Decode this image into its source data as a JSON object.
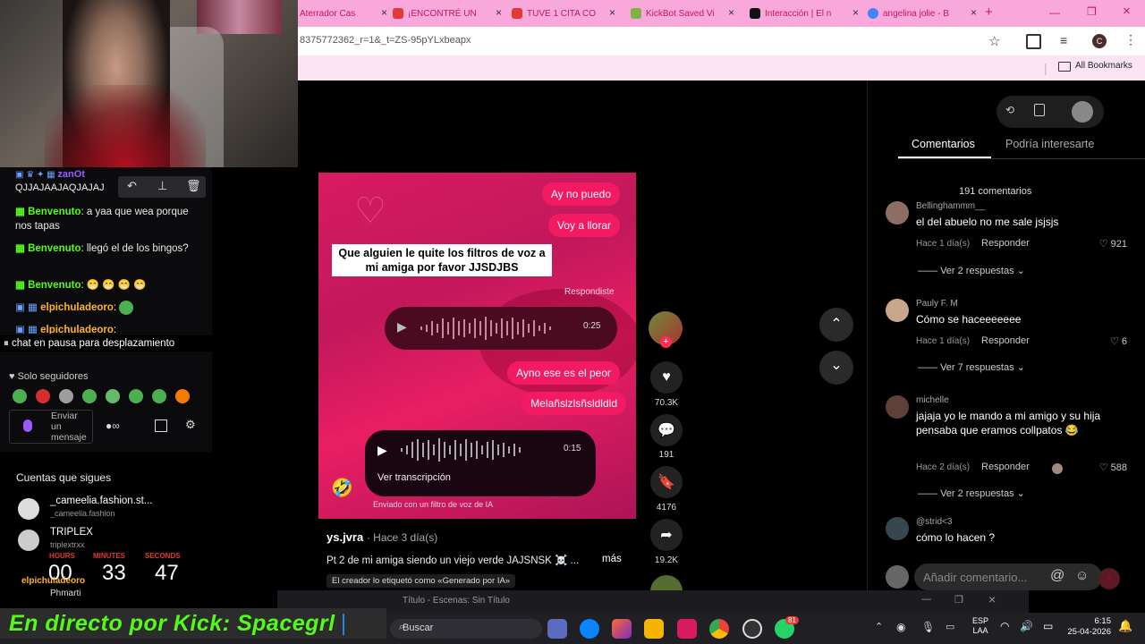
{
  "browser": {
    "tabs": [
      {
        "label": "Aterrador Cas",
        "color": "#d32f2f"
      },
      {
        "label": "¡ENCONTRÉ UN",
        "color": "#e53935"
      },
      {
        "label": "TUVE 1 CITA CO",
        "color": "#e53935"
      },
      {
        "label": "KickBot Saved Vi",
        "color": "#7cb342"
      },
      {
        "label": "Interacción | El n",
        "color": "#111111"
      },
      {
        "label": "angelina jolie - B",
        "color": "#4285f4"
      }
    ],
    "new_tab": "+",
    "url": "8375772362_r=1&_t=ZS-95pYLxbeapx",
    "profile_initial": "C",
    "all_bookmarks": "All Bookmarks"
  },
  "chat": {
    "top_user": "zanOt",
    "top_msg": "QJJAJAAJAQJAJAJ",
    "messages": [
      {
        "user": "Benvenuto",
        "text": "a yaa que wea porque nos tapas"
      },
      {
        "user": "Benvenuto",
        "text": "llegó el de los bingos?"
      },
      {
        "user": "Benvenuto",
        "text": "😁 😁 😁 😁"
      },
      {
        "user": "elpichuladeoro",
        "text": ""
      },
      {
        "user": "elpichuladeoro",
        "text": ""
      }
    ],
    "paused": "chat en pausa para desplazamiento",
    "followers_only": "Solo seguidores",
    "send_placeholder": "Enviar un mensaje"
  },
  "following": {
    "title": "Cuentas que sigues",
    "accounts": [
      {
        "name": "_cameelia.fashion.st...",
        "handle": "_cameelia.fashion"
      },
      {
        "name": "TRIPLEX",
        "handle": "triplextrxx"
      }
    ],
    "timer_labels": {
      "hours": "HOURS",
      "minutes": "MINUTES",
      "seconds": "SECONDS"
    },
    "timer": {
      "hours": "00",
      "minutes": "33",
      "seconds": "47"
    },
    "small_user_1": "elpichuladeoro",
    "small_user_2": "Phmarti"
  },
  "banner": "En directo por Kick: Spacegrl",
  "video": {
    "bubbles_top": [
      "Ay no puedo",
      "Voy a llorar"
    ],
    "caption": "Que alguien le quite los filtros de voz a mi amiga por favor JJSDJBS",
    "respondiste": "Respondiste",
    "audio1_time": "0:25",
    "bubbles_mid": [
      "Ayno ese es el peor",
      "Melañslzlsñsldldld"
    ],
    "audio2_time": "0:15",
    "transcription": "Ver transcripción",
    "ai_note": "Enviado con un filtro de voz de IA",
    "author": "ys.jvra",
    "time_ago": "· Hace 3 día(s)",
    "description": "Pt 2 de mi amiga siendo un viejo verde JAJSNSK ☠️ ...",
    "more": "más",
    "ai_label": "El creador lo etiquetó como «Generado por IA»"
  },
  "actions": {
    "likes": "70.3K",
    "comments": "191",
    "saves": "4176",
    "shares": "19.2K"
  },
  "comments_panel": {
    "tab_comments": "Comentarios",
    "tab_interest": "Podría interesarte",
    "count": "191 comentarios",
    "reply_label": "Responder",
    "items": [
      {
        "user": "Bellinghammm__",
        "text": "el del abuelo no me sale jsjsjs",
        "time": "Hace 1 día(s)",
        "likes": "921",
        "replies": "Ver 2 respuestas"
      },
      {
        "user": "Pauly F. M",
        "text": "Cómo se haceeeeeee",
        "time": "Hace 1 día(s)",
        "likes": "6",
        "replies": "Ver 7 respuestas"
      },
      {
        "user": "michelle",
        "text": "jajaja yo le mando a mi amigo y su hija pensaba que eramos collpatos 😂",
        "time": "Hace 2 día(s)",
        "likes": "588",
        "replies": "Ver 2 respuestas"
      },
      {
        "user": "@strid<3",
        "text": "cómo lo hacen ?",
        "time": "",
        "likes": "",
        "replies": ""
      }
    ],
    "add_placeholder": "Añadir comentario..."
  },
  "obs_bar": "Título - Escenas: Sin Título",
  "taskbar": {
    "search": "Buscar",
    "lang1": "ESP",
    "lang2": "LAA",
    "time": "6:15",
    "date": "25-04-2026",
    "badge": "81"
  }
}
